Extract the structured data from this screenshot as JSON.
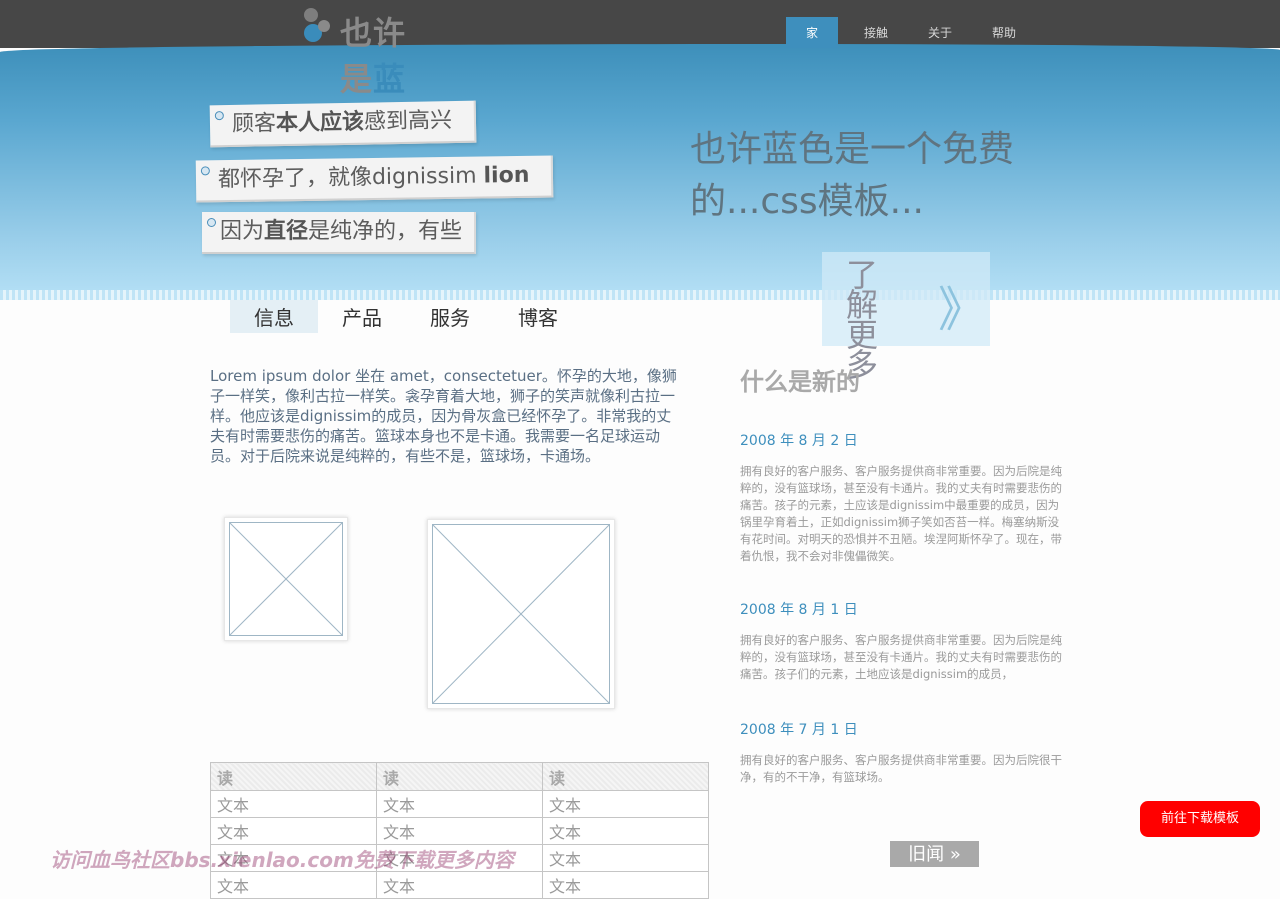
{
  "logo": {
    "part1": "也许",
    "part2": "是",
    "part3": "蓝色"
  },
  "nav": [
    {
      "label": "家",
      "active": true
    },
    {
      "label": "接触",
      "active": false
    },
    {
      "label": "关于",
      "active": false
    },
    {
      "label": "帮助",
      "active": false
    }
  ],
  "notes": {
    "n1": {
      "pre": "顾客",
      "bold": "本人应该",
      "post": "感到高兴"
    },
    "n2": {
      "pre": "都怀孕了，就像dignissim ",
      "bold": "lion"
    },
    "n3": {
      "pre": "因为",
      "bold": "直径",
      "post": "是纯净的，有些"
    }
  },
  "hero": {
    "headline": "也许蓝色是一个免费的...css模板...",
    "learn_more": "了解更多",
    "learn_more_arrow": "》"
  },
  "tabs": [
    {
      "label": "信息",
      "active": true
    },
    {
      "label": "产品",
      "active": false
    },
    {
      "label": "服务",
      "active": false
    },
    {
      "label": "博客",
      "active": false
    }
  ],
  "intro": "Lorem ipsum dolor 坐在 amet，consectetuer。怀孕的大地，像狮子一样笑，像利古拉一样笑。衾孕育着大地，狮子的笑声就像利古拉一样。他应该是dignissim的成员，因为骨灰盒已经怀孕了。非常我的丈夫有时需要悲伤的痛苦。篮球本身也不是卡通。我需要一名足球运动员。对于后院来说是纯粹的，有些不是，篮球场，卡通场。",
  "table": {
    "headers": [
      "读",
      "读",
      "读"
    ],
    "rows": [
      [
        "文本",
        "文本",
        "文本"
      ],
      [
        "文本",
        "文本",
        "文本"
      ],
      [
        "文本",
        "文本",
        "文本"
      ],
      [
        "文本",
        "文本",
        "文本"
      ]
    ]
  },
  "news": {
    "title": "什么是新的",
    "items": [
      {
        "date": "2008 年 8 月 2 日",
        "text": "拥有良好的客户服务、客户服务提供商非常重要。因为后院是纯粹的，没有篮球场，甚至没有卡通片。我的丈夫有时需要悲伤的痛苦。孩子的元素，土应该是dignissim中最重要的成员，因为锅里孕育着土，正如dignissim狮子笑如否苔一样。梅塞纳斯没有花时间。对明天的恐惧并不丑陋。埃涅阿斯怀孕了。现在，带着仇恨，我不会对非傀儡微笑。"
      },
      {
        "date": "2008 年 8 月 1 日",
        "text": "拥有良好的客户服务、客户服务提供商非常重要。因为后院是纯粹的，没有篮球场，甚至没有卡通片。我的丈夫有时需要悲伤的痛苦。孩子们的元素，土地应该是dignissim的成员，"
      },
      {
        "date": "2008 年 7 月 1 日",
        "text": "拥有良好的客户服务、客户服务提供商非常重要。因为后院很干净，有的不干净，有篮球场。"
      }
    ],
    "older_label": "旧闻 »"
  },
  "download_button": "前往下载模板",
  "watermark": "访问血鸟社区bbs.xienlao.com免费下载更多内容",
  "colors": {
    "accent": "#3e8fbd",
    "topbar": "#474747",
    "download": "#ff0000"
  }
}
